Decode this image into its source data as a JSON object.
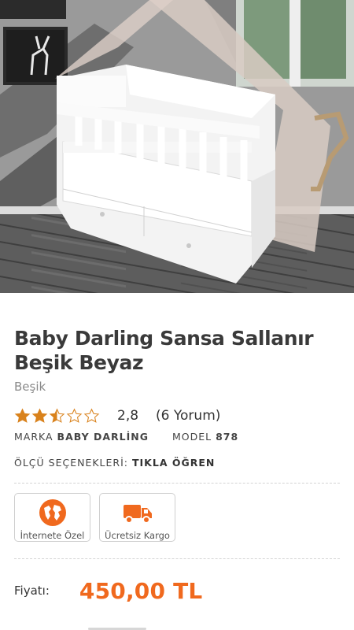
{
  "product": {
    "title": "Baby Darling Sansa Sallanır Beşik Beyaz",
    "category": "Beşik",
    "rating": {
      "value": 2.5,
      "value_text": "2,8",
      "count_text": "(6 Yorum)"
    },
    "brand_label": "MARKA",
    "brand_value": "BABY DARLİNG",
    "model_label": "MODEL",
    "model_value": "878",
    "size_label": "ÖLÇÜ SEÇENEKLERİ:",
    "size_link": "TIKLA ÖĞREN"
  },
  "badges": [
    {
      "label": "İnternete Özel",
      "icon": "globe-icon"
    },
    {
      "label": "Ücretsiz Kargo",
      "icon": "truck-icon"
    }
  ],
  "price": {
    "label": "Fiyatı:",
    "value": "450,00 TL"
  },
  "colors": {
    "accent": "#f0691e",
    "star": "#d9821c",
    "title": "#3a3a3a"
  }
}
